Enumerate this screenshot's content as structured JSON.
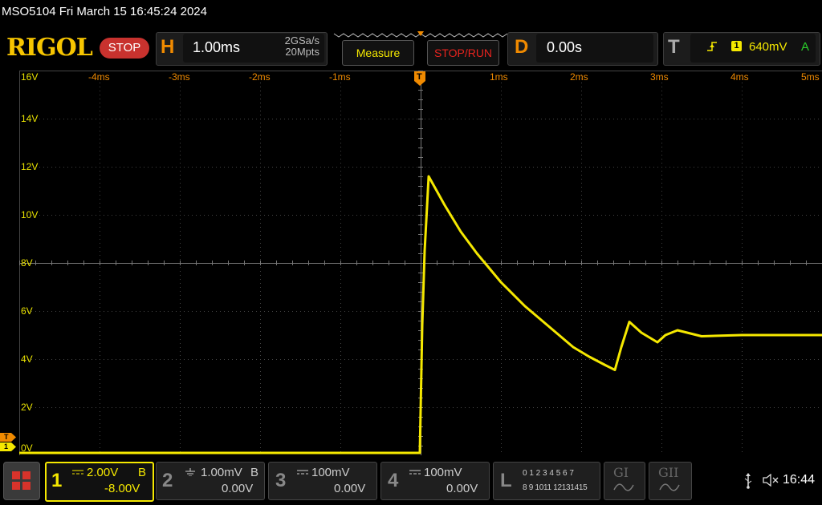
{
  "window": {
    "title": "MSO5104  Fri March 15 16:45:24 2024"
  },
  "header": {
    "logo": "RIGOL",
    "run_state": "STOP",
    "horizontal": {
      "letter": "H",
      "timebase": "1.00ms",
      "sample_rate": "2GSa/s",
      "memory_depth": "20Mpts"
    },
    "measure_label": "Measure",
    "stop_run_label": "STOP/RUN",
    "delay": {
      "letter": "D",
      "value": "0.00s"
    },
    "trigger": {
      "letter": "T",
      "channel": "1",
      "level": "640mV",
      "mode": "A"
    }
  },
  "display": {
    "y_ticks": [
      "16V",
      "14V",
      "12V",
      "10V",
      "8V",
      "6V",
      "4V",
      "2V",
      "0V"
    ],
    "x_ticks": [
      "-4ms",
      "-3ms",
      "-2ms",
      "-1ms",
      "1ms",
      "2ms",
      "3ms",
      "4ms",
      "5ms"
    ],
    "trigger_marker": "T",
    "left_markers": [
      "T",
      "1"
    ]
  },
  "chart_data": {
    "type": "line",
    "title": "",
    "xlabel": "",
    "ylabel": "",
    "x_unit": "ms",
    "y_unit": "V",
    "xlim": [
      -5,
      5
    ],
    "ylim": [
      0,
      16
    ],
    "series": [
      {
        "x": [
          -5,
          -0.01,
          0.02,
          0.05,
          0.1,
          0.3,
          0.5,
          0.7,
          1.0,
          1.3,
          1.6,
          1.9,
          2.1,
          2.3,
          2.42,
          2.5,
          2.6,
          2.75,
          2.95,
          3.05,
          3.2,
          3.5,
          4.0,
          5.0
        ],
        "y": [
          0.1,
          0.1,
          5.4,
          8.5,
          11.6,
          10.4,
          9.3,
          8.4,
          7.2,
          6.2,
          5.35,
          4.5,
          4.1,
          3.75,
          3.55,
          4.5,
          5.55,
          5.1,
          4.7,
          5.0,
          5.2,
          4.95,
          5.0,
          5.0
        ]
      }
    ],
    "colors": {
      "ch1": "#f5e800"
    }
  },
  "footer": {
    "ch1": {
      "num": "1",
      "scale": "2.00V",
      "bw": "B",
      "offset": "-8.00V"
    },
    "ch2": {
      "num": "2",
      "scale": "1.00mV",
      "bw": "B",
      "offset": "0.00V"
    },
    "ch3": {
      "num": "3",
      "scale": "100mV",
      "offset": "0.00V"
    },
    "ch4": {
      "num": "4",
      "scale": "100mV",
      "offset": "0.00V"
    },
    "logic": {
      "letter": "L",
      "row1": "0 1 2 3  4 5 6 7",
      "row2": "8 9 1011 12131415"
    },
    "gen1": "GI",
    "gen2": "GII",
    "clock": "16:44"
  }
}
